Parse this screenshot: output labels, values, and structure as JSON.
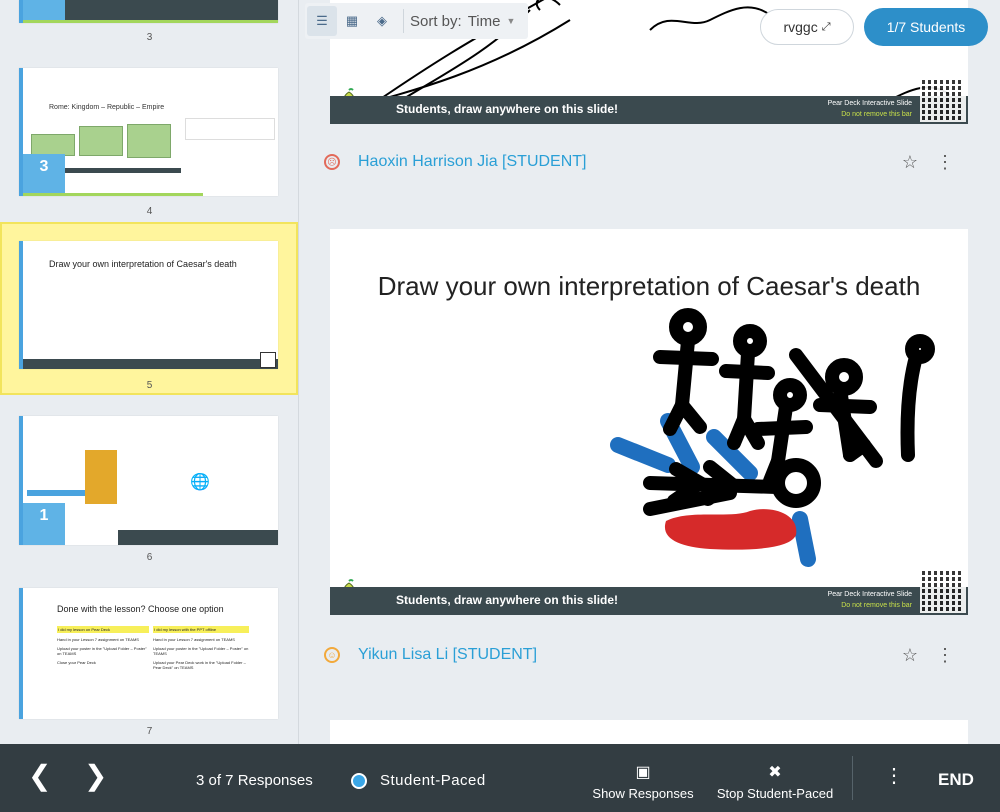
{
  "sidebar": {
    "slides": [
      {
        "number": "3"
      },
      {
        "number": "4",
        "title": "Rome: Kingdom – Republic – Empire",
        "avatar_count": "3"
      },
      {
        "number": "5",
        "title": "Draw your own interpretation of Caesar's death"
      },
      {
        "number": "6",
        "avatar_count": "1"
      },
      {
        "number": "7",
        "title": "Done with the lesson? Choose one option",
        "col1_head": "I did my lesson on Pear Deck",
        "col2_head": "I did my lesson with the PPT offline",
        "col1_items": [
          "Hand in your Lesson 7 assignment on TEAMS",
          "Upload your poster in the \"Upload Folder – Poster\" on TEAMS",
          "Close your Pear Deck"
        ],
        "col2_items": [
          "Hand in your Lesson 7 assignment on TEAMS",
          "Upload your poster in the \"Upload Folder – Poster\" on TEAMS",
          "Upload your Pear Deck work in the \"Upload Folder – Pear Deck\" on TEAMS"
        ]
      }
    ]
  },
  "toolbar": {
    "sort_label": "Sort by:",
    "sort_value": "Time"
  },
  "header": {
    "code": "rvggc",
    "students": "1/7 Students"
  },
  "responses": [
    {
      "student": "Haoxin Harrison Jia [STUDENT]",
      "mood": "sad"
    },
    {
      "student": "Yikun Lisa Li [STUDENT]",
      "mood": "happy",
      "slide_title": "Draw your own interpretation of Caesar's death"
    }
  ],
  "slide_bar": {
    "text": "Students, draw anywhere on this slide!",
    "right1": "Pear Deck Interactive Slide",
    "right2": "Do not remove this bar"
  },
  "bottom": {
    "responses": "3 of 7 Responses",
    "mode": "Student-Paced",
    "show_responses": "Show Responses",
    "stop_paced": "Stop Student-Paced",
    "end": "END"
  },
  "colors": {
    "accent": "#2d8fc9",
    "name": "#2a9fd6",
    "bottom_bar": "#333d42",
    "highlight": "#fff59d"
  }
}
